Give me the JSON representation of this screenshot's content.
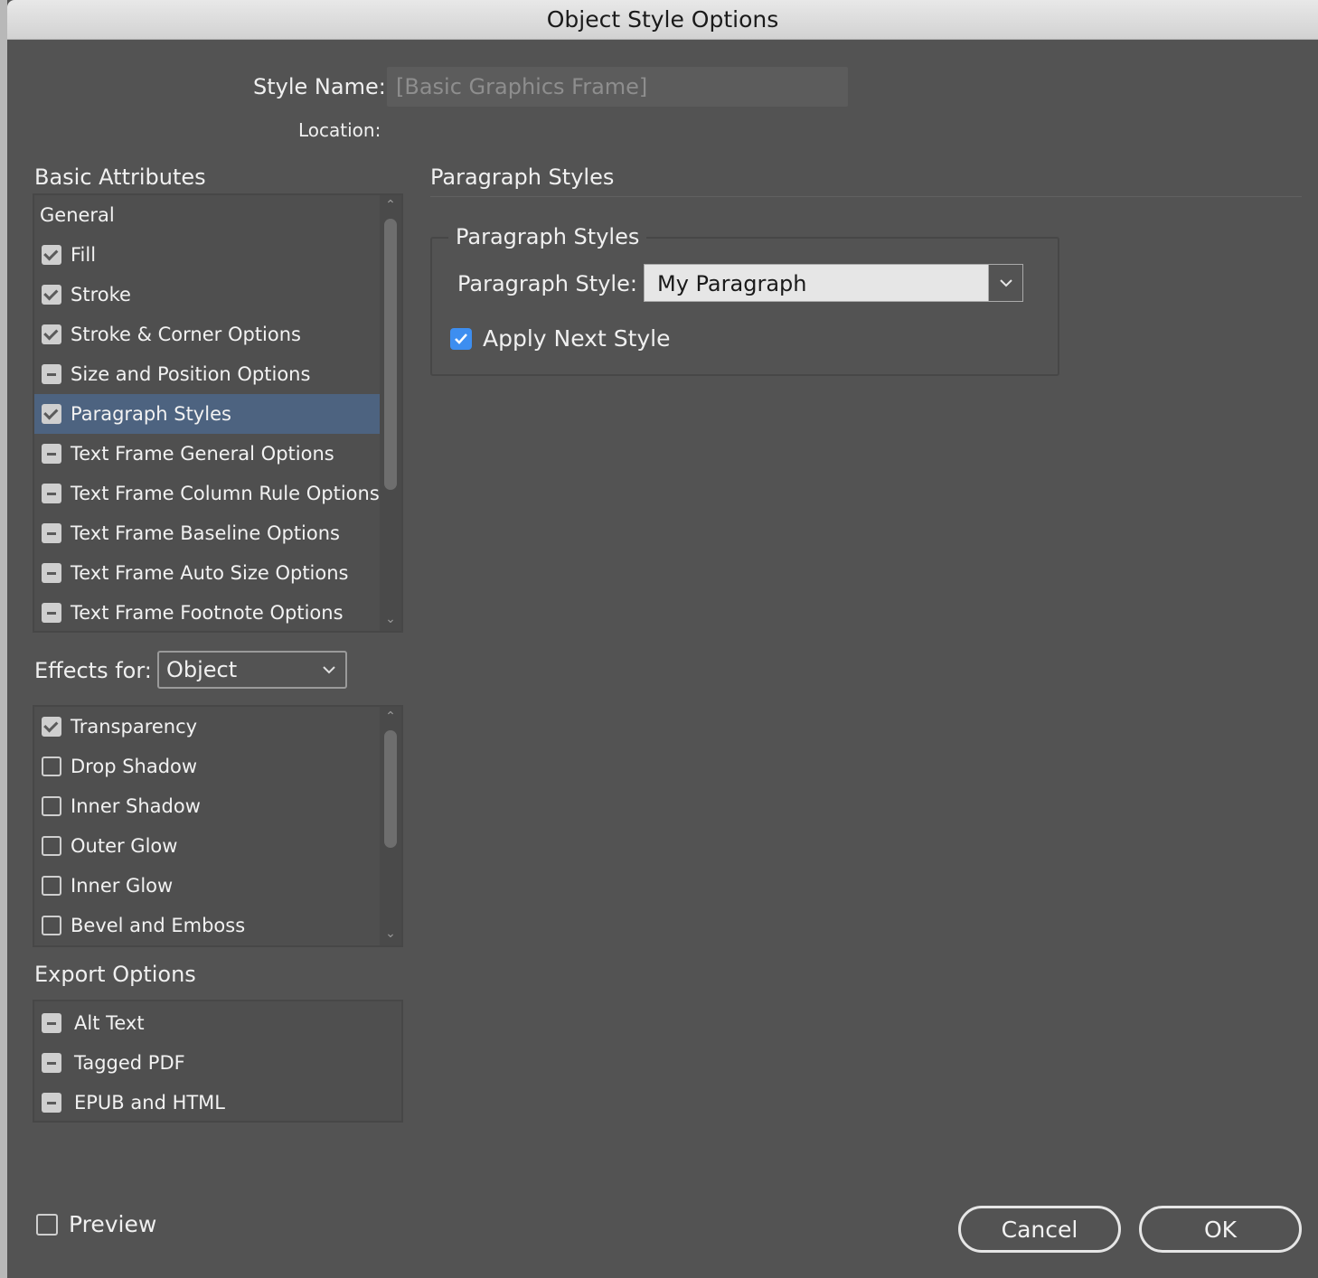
{
  "window": {
    "title": "Object Style Options"
  },
  "header": {
    "style_name_label": "Style Name:",
    "style_name_value": "[Basic Graphics Frame]",
    "location_label": "Location:"
  },
  "basic_attributes": {
    "title": "Basic Attributes",
    "items": [
      {
        "label": "General",
        "state": "none"
      },
      {
        "label": "Fill",
        "state": "checked"
      },
      {
        "label": "Stroke",
        "state": "checked"
      },
      {
        "label": "Stroke & Corner Options",
        "state": "checked"
      },
      {
        "label": "Size and Position Options",
        "state": "mixed"
      },
      {
        "label": "Paragraph Styles",
        "state": "checked",
        "selected": true
      },
      {
        "label": "Text Frame General Options",
        "state": "mixed"
      },
      {
        "label": "Text Frame Column Rule Options",
        "state": "mixed"
      },
      {
        "label": "Text Frame Baseline Options",
        "state": "mixed"
      },
      {
        "label": "Text Frame Auto Size Options",
        "state": "mixed"
      },
      {
        "label": "Text Frame Footnote Options",
        "state": "mixed"
      }
    ]
  },
  "effects": {
    "label": "Effects for:",
    "selected": "Object",
    "items": [
      {
        "label": "Transparency",
        "state": "checked"
      },
      {
        "label": "Drop Shadow",
        "state": "unchecked"
      },
      {
        "label": "Inner Shadow",
        "state": "unchecked"
      },
      {
        "label": "Outer Glow",
        "state": "unchecked"
      },
      {
        "label": "Inner Glow",
        "state": "unchecked"
      },
      {
        "label": "Bevel and Emboss",
        "state": "unchecked"
      }
    ]
  },
  "export_options": {
    "title": "Export Options",
    "items": [
      {
        "label": "Alt Text",
        "state": "mixed"
      },
      {
        "label": "Tagged PDF",
        "state": "mixed"
      },
      {
        "label": "EPUB and HTML",
        "state": "mixed"
      }
    ]
  },
  "panel": {
    "title": "Paragraph Styles",
    "group_title": "Paragraph Styles",
    "paragraph_style_label": "Paragraph Style:",
    "paragraph_style_value": "My Paragraph",
    "apply_next_label": "Apply Next Style",
    "apply_next_checked": true
  },
  "footer": {
    "preview_label": "Preview",
    "cancel_label": "Cancel",
    "ok_label": "OK"
  },
  "colors": {
    "background": "#535353",
    "selection": "#4d6380",
    "accent_checkbox": "#3d8ef0"
  }
}
